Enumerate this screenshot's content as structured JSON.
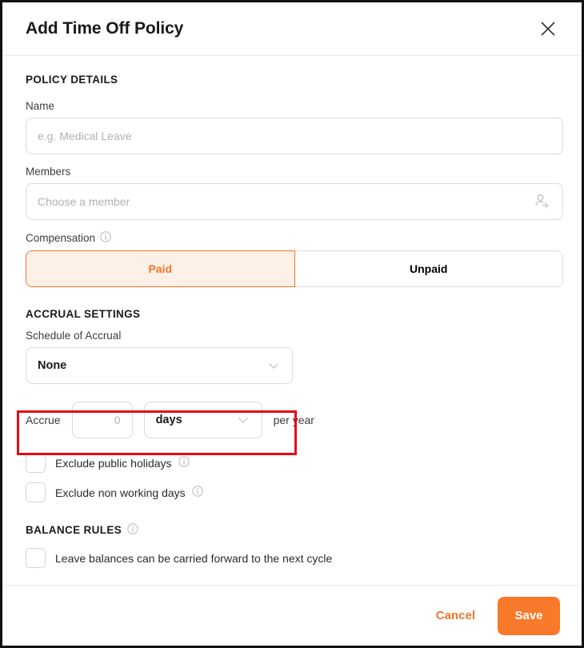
{
  "dialog": {
    "title": "Add Time Off Policy",
    "close_icon": "close-icon"
  },
  "sections": {
    "policy_details": {
      "heading": "POLICY DETAILS",
      "name": {
        "label": "Name",
        "value": "",
        "placeholder": "e.g. Medical Leave"
      },
      "members": {
        "label": "Members",
        "value": "",
        "placeholder": "Choose a member",
        "icon": "add-member-icon"
      },
      "compensation": {
        "label": "Compensation",
        "info_icon": "info-icon",
        "options": [
          "Paid",
          "Unpaid"
        ],
        "selected": "Paid"
      }
    },
    "accrual_settings": {
      "heading": "ACCRUAL SETTINGS",
      "schedule": {
        "label": "Schedule of Accrual",
        "value": "None",
        "chevron_icon": "chevron-down-icon"
      },
      "accrue": {
        "prefix_label": "Accrue",
        "amount_value": "",
        "amount_placeholder": "0",
        "unit_value": "days",
        "unit_chevron_icon": "chevron-down-icon",
        "suffix_label": "per year"
      },
      "exclude_public_holidays": {
        "label": "Exclude public holidays",
        "checked": false,
        "info_icon": "info-icon"
      },
      "exclude_non_working_days": {
        "label": "Exclude non working days",
        "checked": false,
        "info_icon": "info-icon"
      }
    },
    "balance_rules": {
      "heading": "BALANCE RULES",
      "info_icon": "info-icon",
      "carry_forward": {
        "label": "Leave balances can be carried forward to the next cycle",
        "checked": false
      }
    }
  },
  "footer": {
    "cancel_label": "Cancel",
    "save_label": "Save"
  },
  "colors": {
    "accent_orange": "#f9792b",
    "accent_orange_text": "#f2752b",
    "selected_fill": "#fdf0e6",
    "highlight_red": "#e50914"
  }
}
